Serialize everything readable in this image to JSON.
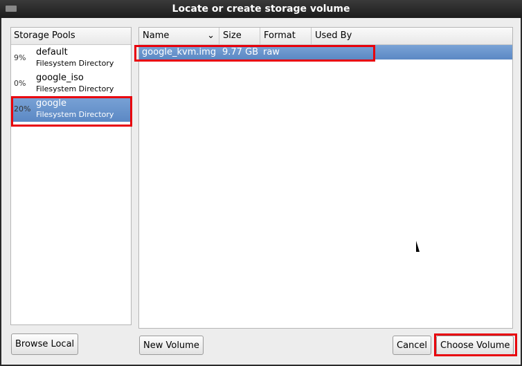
{
  "window": {
    "title": "Locate or create storage volume"
  },
  "pools": {
    "header": "Storage Pools",
    "items": [
      {
        "percent": "9%",
        "name": "default",
        "type": "Filesystem Directory"
      },
      {
        "percent": "0%",
        "name": "google_iso",
        "type": "Filesystem Directory"
      },
      {
        "percent": "20%",
        "name": "google",
        "type": "Filesystem Directory",
        "selected": true
      }
    ]
  },
  "volumes": {
    "columns": [
      "Name",
      "Size",
      "Format",
      "Used By"
    ],
    "rows": [
      {
        "name": "google_kvm.img",
        "size": "9.77 GB",
        "format": "raw",
        "used_by": ""
      }
    ]
  },
  "buttons": {
    "browse_local": "Browse Local",
    "new_volume": "New Volume",
    "cancel": "Cancel",
    "choose_volume": "Choose Volume"
  },
  "colors": {
    "selection": "#6a96cd",
    "highlight_box": "#e8000b"
  }
}
